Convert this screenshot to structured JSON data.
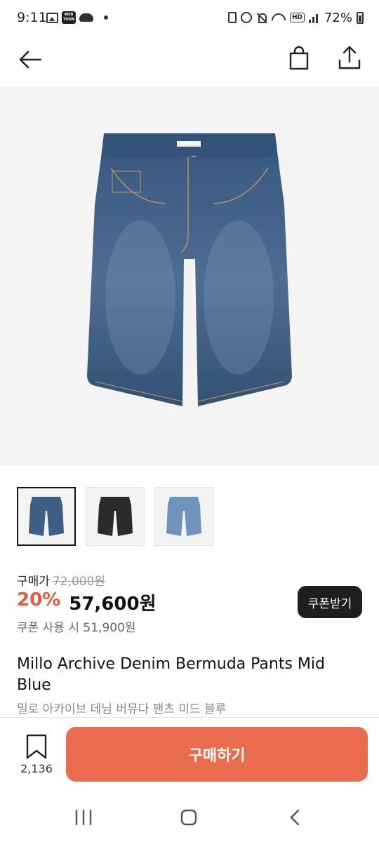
{
  "status_bar": {
    "time": "9:11",
    "battery": "72%",
    "icons_left": [
      "image-icon",
      "webtoon-icon",
      "cloud-icon",
      "dot-icon"
    ],
    "icons_right": [
      "lock-icon",
      "alarm-icon",
      "mute-icon",
      "wifi-icon",
      "hd-icon",
      "signal-icon",
      "battery-icon"
    ],
    "webtoon_label": "WEB TOON",
    "hd_label": "HD"
  },
  "nav": {
    "back_icon": "arrow-left-icon",
    "bag_icon": "shopping-bag-icon",
    "share_icon": "share-icon"
  },
  "product": {
    "thumbnails": [
      {
        "name": "thumbnail-mid-blue",
        "color": "#3d5e85",
        "selected": true
      },
      {
        "name": "thumbnail-black",
        "color": "#2b2b2b",
        "selected": false
      },
      {
        "name": "thumbnail-light-blue",
        "color": "#6f93bd",
        "selected": false
      }
    ],
    "price_label": "구매가",
    "original_price": "72,000원",
    "discount": "20%",
    "final_price": "57,600원",
    "coupon_note": "쿠폰 사용 시 51,900원",
    "coupon_button": "쿠폰받기",
    "name": "Millo Archive Denim Bermuda Pants Mid Blue",
    "subname": "밀로 아카이브 데님 버뮤다 팬츠 미드 블루"
  },
  "bottom_bar": {
    "bookmark_count": "2,136",
    "buy_label": "구매하기"
  },
  "colors": {
    "accent": "#ea6c4f",
    "discount": "#e55a3e",
    "denim": "#3d5e85"
  }
}
